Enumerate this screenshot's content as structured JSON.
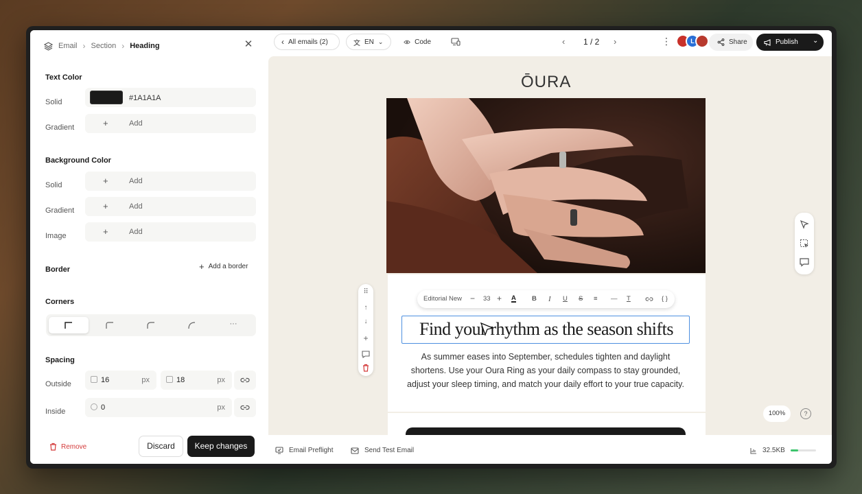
{
  "breadcrumb": {
    "items": [
      "Email",
      "Section",
      "Heading"
    ]
  },
  "text_color": {
    "title": "Text Color",
    "solid_label": "Solid",
    "solid_hex": "#1A1A1A",
    "gradient_label": "Gradient",
    "gradient_add": "Add"
  },
  "background_color": {
    "title": "Background Color",
    "solid_label": "Solid",
    "gradient_label": "Gradient",
    "image_label": "Image",
    "add_label": "Add"
  },
  "border": {
    "title": "Border",
    "add_label": "Add a border"
  },
  "corners": {
    "title": "Corners",
    "more": "···"
  },
  "spacing": {
    "title": "Spacing",
    "outside_label": "Outside",
    "outside_top": "16",
    "outside_side": "18",
    "inside_label": "Inside",
    "inside_value": "0",
    "unit": "px"
  },
  "footer": {
    "remove": "Remove",
    "discard": "Discard",
    "keep": "Keep changes"
  },
  "topbar": {
    "all_emails": "All emails (2)",
    "language": "EN",
    "code": "Code",
    "page": "1 / 2",
    "avatar_letter": "L",
    "share": "Share",
    "publish": "Publish"
  },
  "email": {
    "logo": "ŌURA",
    "heading": "Find your rhythm as the season shifts",
    "body": "As summer eases into September, schedules tighten and daylight shortens. Use your Oura Ring as your daily compass to stay grounded, adjust your sleep timing, and match your daily effort to your true capacity."
  },
  "format_toolbar": {
    "font": "Editorial New",
    "size": "33",
    "variable": "{ }"
  },
  "zoom": "100%",
  "bottombar": {
    "preflight": "Email Preflight",
    "test": "Send Test Email",
    "size": "32.5KB",
    "size_progress": 0.3
  },
  "colors": {
    "accent_blue": "#4C8FE0",
    "dark": "#1A1A1A",
    "danger": "#D43B3B",
    "canvas": "#F2EEE6",
    "progress": "#3CC46C"
  }
}
